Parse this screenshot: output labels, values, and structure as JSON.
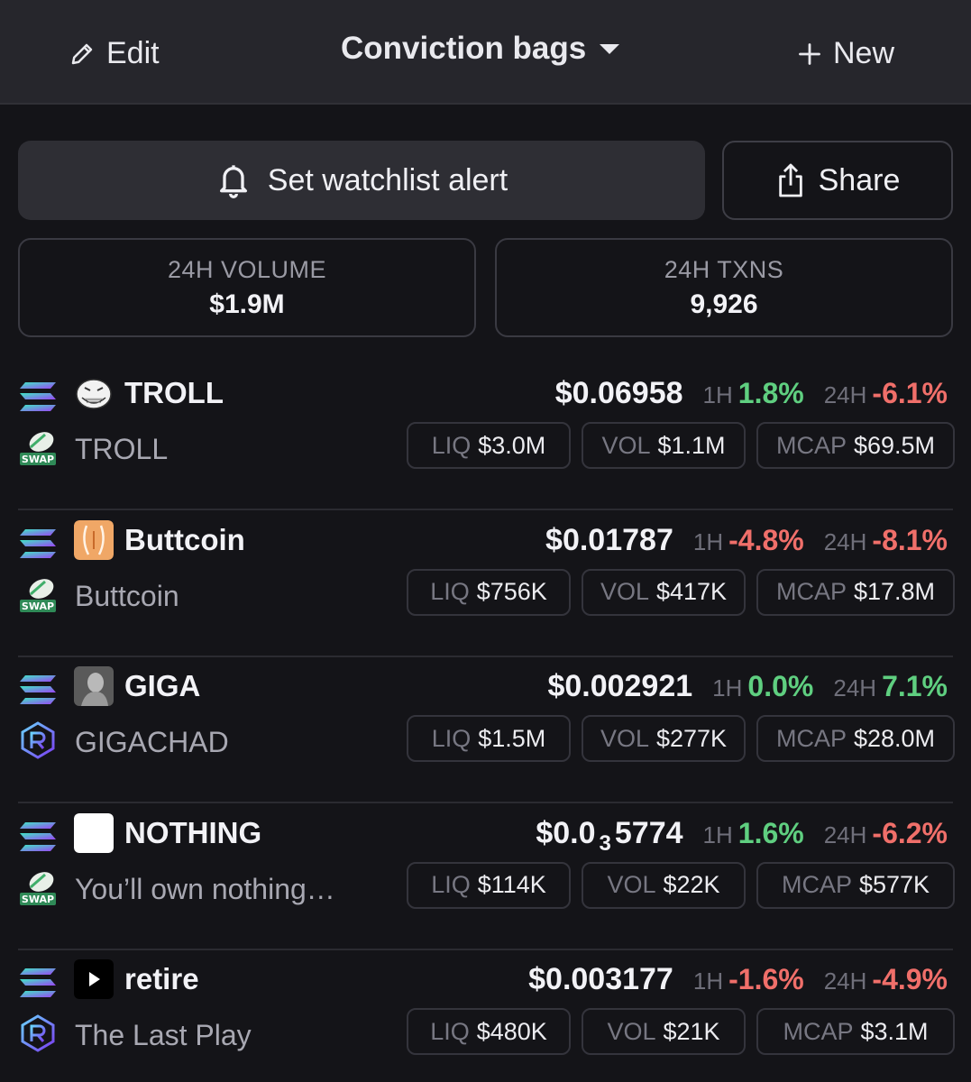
{
  "header": {
    "edit_label": "Edit",
    "title": "Conviction bags",
    "new_label": "New"
  },
  "actions": {
    "alert_label": "Set watchlist alert",
    "share_label": "Share"
  },
  "stats": {
    "volume_label": "24H VOLUME",
    "volume_value": "$1.9M",
    "txns_label": "24H TXNS",
    "txns_value": "9,926"
  },
  "labels": {
    "h1": "1H",
    "h24": "24H",
    "liq": "LIQ",
    "vol": "VOL",
    "mcap": "MCAP"
  },
  "tokens": [
    {
      "symbol": "TROLL",
      "name": "TROLL",
      "dex": "swap",
      "avatar": "troll-face",
      "price": "$0.06958",
      "h1": "1.8%",
      "h1_dir": "pos",
      "h24": "-6.1%",
      "h24_dir": "neg",
      "liq": "$3.0M",
      "vol": "$1.1M",
      "mcap": "$69.5M"
    },
    {
      "symbol": "Buttcoin",
      "name": "Buttcoin",
      "dex": "swap",
      "avatar": "buttcoin",
      "price": "$0.01787",
      "h1": "-4.8%",
      "h1_dir": "neg",
      "h24": "-8.1%",
      "h24_dir": "neg",
      "liq": "$756K",
      "vol": "$417K",
      "mcap": "$17.8M"
    },
    {
      "symbol": "GIGA",
      "name": "GIGACHAD",
      "dex": "raydium",
      "avatar": "gigachad",
      "price": "$0.002921",
      "h1": "0.0%",
      "h1_dir": "pos",
      "h24": "7.1%",
      "h24_dir": "pos",
      "liq": "$1.5M",
      "vol": "$277K",
      "mcap": "$28.0M"
    },
    {
      "symbol": "NOTHING",
      "name": "You’ll own nothing…",
      "dex": "swap",
      "avatar": "blank-white",
      "price_prefix": "$0.0",
      "price_sub": "3",
      "price_rest": "5774",
      "h1": "1.6%",
      "h1_dir": "pos",
      "h24": "-6.2%",
      "h24_dir": "neg",
      "liq": "$114K",
      "vol": "$22K",
      "mcap": "$577K"
    },
    {
      "symbol": "retire",
      "name": "The Last Play",
      "dex": "raydium",
      "avatar": "play",
      "price": "$0.003177",
      "h1": "-1.6%",
      "h1_dir": "neg",
      "h24": "-4.9%",
      "h24_dir": "neg",
      "liq": "$480K",
      "vol": "$21K",
      "mcap": "$3.1M"
    }
  ],
  "colors": {
    "positive": "#5fcf80",
    "negative": "#f06f6a",
    "background": "#141418",
    "header": "#26262c"
  }
}
